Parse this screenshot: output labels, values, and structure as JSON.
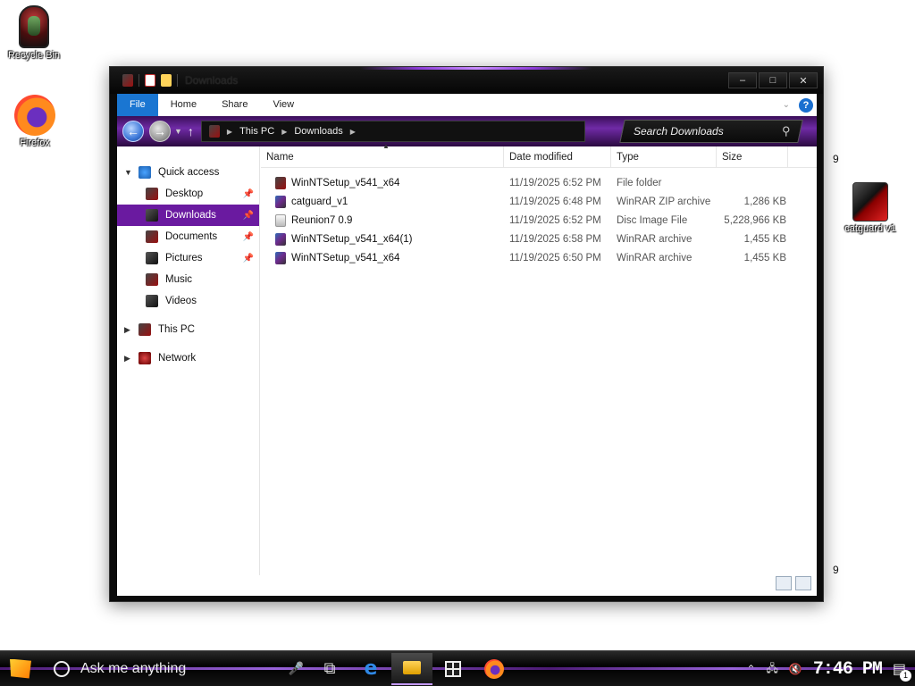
{
  "desktop": {
    "recycle_bin": "Recycle Bin",
    "firefox": "Firefox",
    "catguard": "catguard v1",
    "side_number_top": "9",
    "side_number_bottom": "9"
  },
  "window": {
    "title": "Downloads",
    "buttons": {
      "minimize": "–",
      "maximize": "□",
      "close": "✕"
    }
  },
  "ribbon": {
    "tabs": [
      "File",
      "Home",
      "Share",
      "View"
    ],
    "help": "?"
  },
  "navbar": {
    "breadcrumb": [
      "This PC",
      "Downloads"
    ],
    "search_placeholder": "Search Downloads"
  },
  "nav_pane": {
    "quick_access": "Quick access",
    "items": [
      {
        "label": "Desktop",
        "pinned": true
      },
      {
        "label": "Downloads",
        "pinned": true,
        "selected": true
      },
      {
        "label": "Documents",
        "pinned": true
      },
      {
        "label": "Pictures",
        "pinned": true
      },
      {
        "label": "Music",
        "pinned": false
      },
      {
        "label": "Videos",
        "pinned": false
      }
    ],
    "this_pc": "This PC",
    "network": "Network"
  },
  "file_list": {
    "columns": [
      "Name",
      "Date modified",
      "Type",
      "Size"
    ],
    "rows": [
      {
        "name": "WinNTSetup_v541_x64",
        "date": "11/19/2025 6:52 PM",
        "type": "File folder",
        "size": ""
      },
      {
        "name": "catguard_v1",
        "date": "11/19/2025 6:48 PM",
        "type": "WinRAR ZIP archive",
        "size": "1,286 KB"
      },
      {
        "name": "Reunion7 0.9",
        "date": "11/19/2025 6:52 PM",
        "type": "Disc Image File",
        "size": "5,228,966 KB"
      },
      {
        "name": "WinNTSetup_v541_x64(1)",
        "date": "11/19/2025 6:58 PM",
        "type": "WinRAR archive",
        "size": "1,455 KB"
      },
      {
        "name": "WinNTSetup_v541_x64",
        "date": "11/19/2025 6:50 PM",
        "type": "WinRAR archive",
        "size": "1,455 KB"
      }
    ]
  },
  "taskbar": {
    "search_placeholder": "Ask me anything",
    "clock": "7:46 PM",
    "notifications": "1"
  },
  "colors": {
    "accent_purple": "#6a1aa0",
    "file_tab_blue": "#1a76d2"
  }
}
